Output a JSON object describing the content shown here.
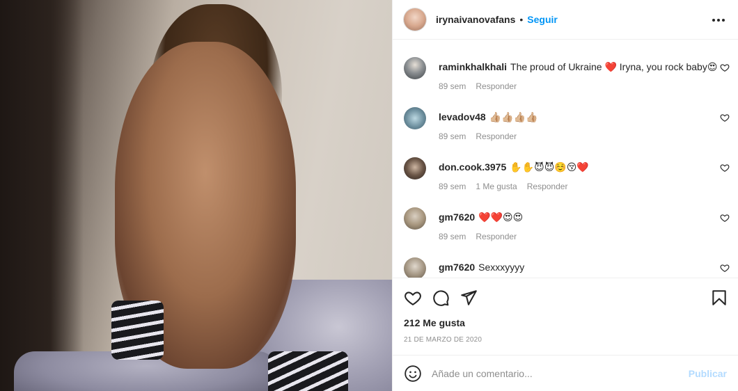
{
  "header": {
    "username": "irynaivanovafans",
    "separator": "•",
    "follow_label": "Seguir",
    "more_icon": "more-horizontal-icon"
  },
  "comments": [
    {
      "user": "raminkhalkhali",
      "text": "The proud of Ukraine ❤️ Iryna, you rock baby😍",
      "time": "89 sem",
      "likes": "",
      "reply": "Responder"
    },
    {
      "user": "levadov48",
      "text": "👍🏼👍🏼👍🏼👍🏼",
      "time": "89 sem",
      "likes": "",
      "reply": "Responder"
    },
    {
      "user": "don.cook.3975",
      "text": "✋✋😈😈☺️😚❤️",
      "time": "89 sem",
      "likes": "1 Me gusta",
      "reply": "Responder"
    },
    {
      "user": "gm7620",
      "text": "❤️❤️😍😍",
      "time": "89 sem",
      "likes": "",
      "reply": "Responder"
    },
    {
      "user": "gm7620",
      "text": "Sexxxyyyy",
      "time": "",
      "likes": "",
      "reply": ""
    }
  ],
  "actions": {
    "like_icon": "heart-icon",
    "comment_icon": "comment-icon",
    "share_icon": "send-icon",
    "save_icon": "bookmark-icon"
  },
  "likes_text": "212 Me gusta",
  "date_text": "21 de marzo de 2020",
  "add_comment": {
    "placeholder": "Añade un comentario...",
    "publish_label": "Publicar",
    "publish_color": "#b3dbff"
  },
  "colors": {
    "link": "#0095f6",
    "text": "#262626",
    "muted": "#8e8e8e",
    "border": "#efefef"
  }
}
